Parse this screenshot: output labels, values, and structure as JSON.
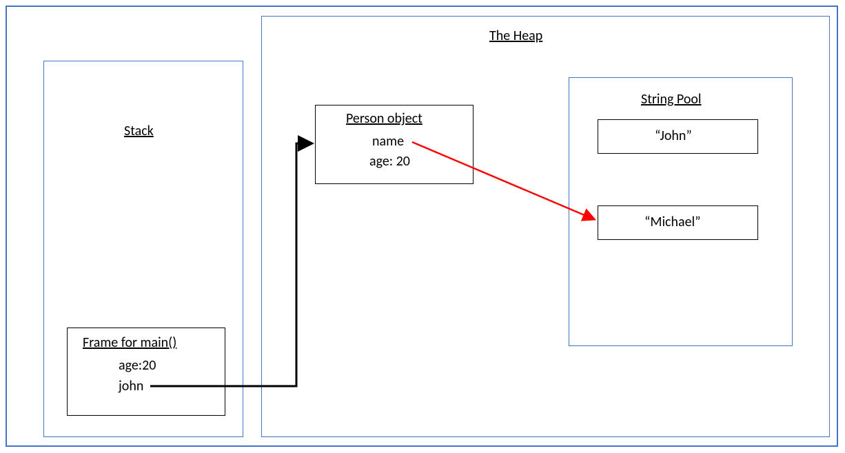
{
  "titles": {
    "stack": "Stack",
    "heap": "The Heap",
    "string_pool": "String Pool"
  },
  "stack_frame": {
    "title": "Frame for main()",
    "line1": "age:20",
    "line2": "john"
  },
  "person_object": {
    "title": "Person object",
    "line1": "name",
    "line2": "age: 20"
  },
  "string_pool": {
    "entry1": "“John”",
    "entry2": "“Michael”"
  },
  "arrows": {
    "black": {
      "from": "stack_frame.john",
      "to": "person_object",
      "color": "#000000"
    },
    "red": {
      "from": "person_object.name",
      "to": "string_pool.entry2",
      "color": "#FF0000"
    }
  },
  "chart_data": {
    "type": "diagram",
    "title": "Java memory model: Stack and Heap",
    "regions": [
      {
        "name": "Stack",
        "contains": [
          {
            "name": "Frame for main()",
            "variables": [
              {
                "name": "age",
                "value": 20,
                "type": "int"
              },
              {
                "name": "john",
                "type": "reference",
                "points_to": "Person object"
              }
            ]
          }
        ]
      },
      {
        "name": "The Heap",
        "contains": [
          {
            "name": "Person object",
            "fields": [
              {
                "name": "name",
                "type": "reference",
                "points_to": "String \"Michael\""
              },
              {
                "name": "age",
                "value": 20,
                "type": "int"
              }
            ]
          },
          {
            "name": "String Pool",
            "strings": [
              "John",
              "Michael"
            ]
          }
        ]
      }
    ],
    "pointers": [
      {
        "from": "Stack > Frame for main() > john",
        "to": "Heap > Person object",
        "color": "black"
      },
      {
        "from": "Heap > Person object > name",
        "to": "Heap > String Pool > \"Michael\"",
        "color": "red"
      }
    ]
  }
}
